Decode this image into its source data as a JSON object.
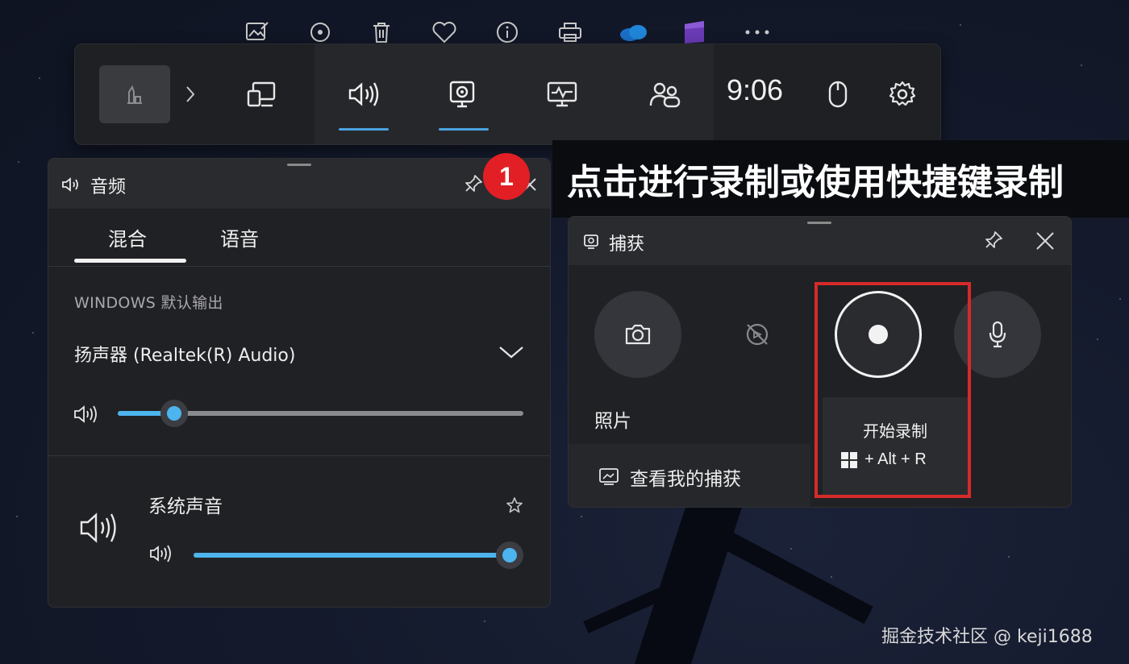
{
  "top_bar": {
    "time": "9:06",
    "icons": [
      "image-edit-icon",
      "replay-icon",
      "trash-icon",
      "heart-icon",
      "info-icon",
      "print-icon",
      "onedrive-icon",
      "app-icon",
      "more-icon"
    ],
    "widgets": [
      "performance-icon",
      "audio-icon",
      "capture-icon",
      "resources-icon",
      "social-icon"
    ],
    "active_widgets": [
      "audio",
      "capture"
    ]
  },
  "audio_panel": {
    "title": "音频",
    "tabs": [
      "混合",
      "语音"
    ],
    "active_tab": "混合",
    "section_label": "WINDOWS 默认输出",
    "device": "扬声器 (Realtek(R) Audio)",
    "master_volume": 0.14,
    "apps": [
      {
        "name": "系统声音",
        "volume": 1.0
      }
    ]
  },
  "callout": {
    "badge": "1",
    "text": "点击进行录制或使用快捷键录制"
  },
  "capture_panel": {
    "title": "捕获",
    "photo_label": "照片",
    "view_captures": "查看我的捕获",
    "record_tooltip": "开始录制",
    "shortcut": "+ Alt + R"
  },
  "watermark": "掘金技术社区 @ keji1688",
  "colors": {
    "accent": "#4cb4ee",
    "highlight_box": "#d62a2a",
    "badge": "#e21f25"
  }
}
